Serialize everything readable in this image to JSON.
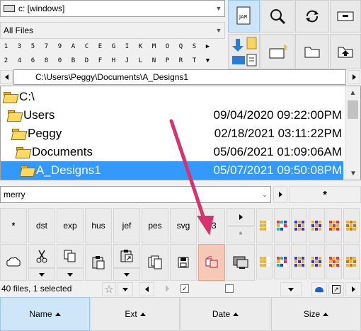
{
  "drive_combo": {
    "value": "c: [windows]"
  },
  "filter_combo": {
    "value": "All Files"
  },
  "letters_row1": [
    "1",
    "3",
    "5",
    "7",
    "9",
    "A",
    "C",
    "E",
    "G",
    "I",
    "K",
    "M",
    "O",
    "Q",
    "S",
    "▶"
  ],
  "letters_row2": [
    "2",
    "4",
    "6",
    "8",
    "0",
    "B",
    "D",
    "F",
    "H",
    "J",
    "L",
    "N",
    "P",
    "R",
    "T",
    "▼"
  ],
  "path_bar": {
    "value": "C:\\Users\\Peggy\\Documents\\A_Designs1"
  },
  "tree": {
    "root": "C:\\",
    "rows": [
      {
        "name": "Users",
        "date": "09/04/2020 09:22:00PM"
      },
      {
        "name": "Peggy",
        "date": "02/18/2021 03:11:22PM"
      },
      {
        "name": "Documents",
        "date": "05/06/2021 01:09:06AM"
      },
      {
        "name": "A_Designs1",
        "date": "05/07/2021 09:50:08PM"
      }
    ]
  },
  "search_combo": {
    "value": "merry"
  },
  "asterisk_label": "*",
  "ext_buttons": [
    "*",
    "dst",
    "exp",
    "hus",
    "jef",
    "pes",
    "svg",
    "63"
  ],
  "small_asterisk": "*",
  "status": {
    "text": "40 files, 1 selected"
  },
  "columns": [
    {
      "label": "Name",
      "active": true
    },
    {
      "label": "Ext",
      "active": false
    },
    {
      "label": "Date",
      "active": false
    },
    {
      "label": "Size",
      "active": false
    }
  ],
  "colors": {
    "selection": "#3399ff",
    "highlight": "#f6c9b6",
    "arrow": "#d6336c",
    "header_active": "#cfe6f8"
  }
}
